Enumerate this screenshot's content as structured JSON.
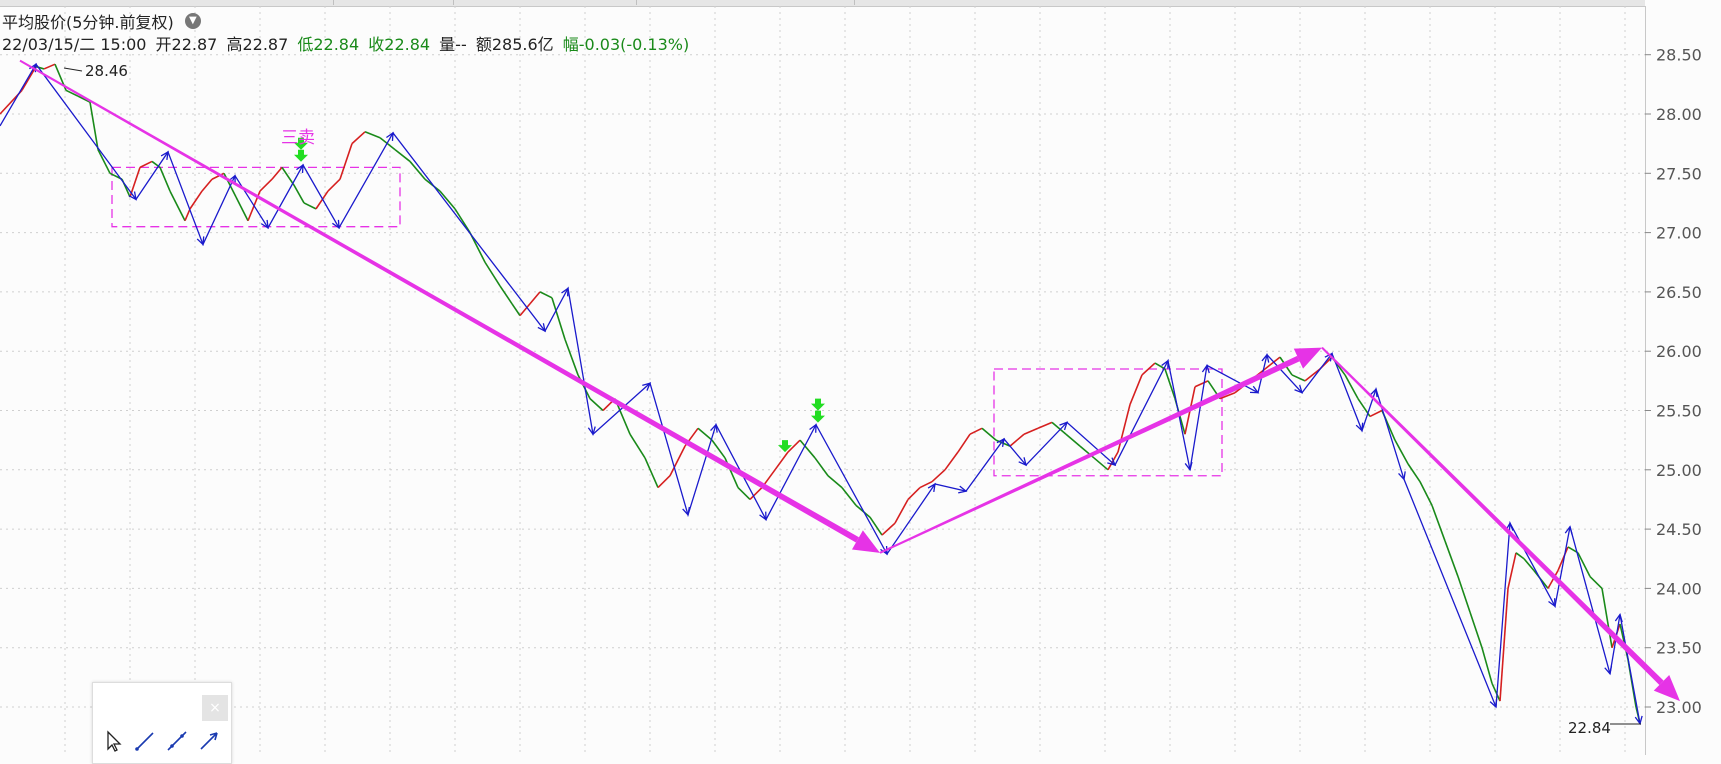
{
  "header": {
    "title": "平均股价(5分钟.前复权)",
    "dropdown_icon": "chevron-down-icon",
    "datetime": "22/03/15/二 15:00",
    "open": "开22.87",
    "high": "高22.87",
    "low": "低22.84",
    "close": "收22.84",
    "volume": "量--",
    "amount": "额285.6亿",
    "change": "幅-0.03(-0.13%)"
  },
  "annotations": {
    "high_marker": "28.46",
    "low_marker": "22.84",
    "signal_label": "三卖"
  },
  "toolbox": {
    "close_label": "×",
    "tools": [
      "cursor-icon",
      "line-icon",
      "segment-icon",
      "arrow-line-icon"
    ]
  },
  "colors": {
    "stroke_line": "#1a1acc",
    "trend_arrow": "#e633e6",
    "zone_box": "#e633e6",
    "up_candle": "#d62020",
    "down_candle": "#1a8a1a",
    "signal_arrow": "#22dd22",
    "grid": "#cfcfcf"
  },
  "chart_data": {
    "type": "line",
    "title": "平均股价(5分钟.前复权)",
    "xlabel": "",
    "ylabel": "",
    "ylim": [
      22.7,
      28.85
    ],
    "y_ticks": [
      "23.00",
      "23.50",
      "24.00",
      "24.50",
      "25.00",
      "25.50",
      "26.00",
      "26.50",
      "27.00",
      "27.50",
      "28.00",
      "28.50"
    ],
    "grid": true,
    "x_index_range": [
      0,
      1640
    ],
    "series": [
      {
        "values": [
          [
            0,
            28.0
          ],
          [
            22,
            28.2
          ],
          [
            36,
            28.4
          ],
          [
            44,
            28.38
          ],
          [
            55,
            28.42
          ],
          [
            66,
            28.2
          ],
          [
            78,
            28.15
          ],
          [
            90,
            28.1
          ],
          [
            98,
            27.7
          ],
          [
            110,
            27.5
          ],
          [
            122,
            27.45
          ],
          [
            130,
            27.3
          ],
          [
            140,
            27.55
          ],
          [
            152,
            27.6
          ],
          [
            160,
            27.55
          ],
          [
            170,
            27.35
          ],
          [
            185,
            27.1
          ],
          [
            190,
            27.2
          ],
          [
            202,
            27.35
          ],
          [
            212,
            27.45
          ],
          [
            224,
            27.5
          ],
          [
            236,
            27.3
          ],
          [
            248,
            27.1
          ],
          [
            260,
            27.35
          ],
          [
            272,
            27.45
          ],
          [
            282,
            27.55
          ],
          [
            294,
            27.4
          ],
          [
            304,
            27.25
          ],
          [
            316,
            27.2
          ],
          [
            328,
            27.35
          ],
          [
            340,
            27.45
          ],
          [
            352,
            27.75
          ],
          [
            365,
            27.85
          ],
          [
            380,
            27.8
          ],
          [
            395,
            27.7
          ],
          [
            410,
            27.6
          ],
          [
            425,
            27.45
          ],
          [
            440,
            27.35
          ],
          [
            455,
            27.2
          ],
          [
            470,
            27.0
          ],
          [
            485,
            26.75
          ],
          [
            500,
            26.55
          ],
          [
            512,
            26.4
          ],
          [
            520,
            26.3
          ],
          [
            530,
            26.4
          ],
          [
            540,
            26.5
          ],
          [
            552,
            26.45
          ],
          [
            565,
            26.1
          ],
          [
            578,
            25.8
          ],
          [
            590,
            25.6
          ],
          [
            603,
            25.5
          ],
          [
            615,
            25.6
          ],
          [
            630,
            25.3
          ],
          [
            645,
            25.1
          ],
          [
            658,
            24.85
          ],
          [
            670,
            24.95
          ],
          [
            685,
            25.2
          ],
          [
            698,
            25.35
          ],
          [
            712,
            25.25
          ],
          [
            725,
            25.1
          ],
          [
            738,
            24.85
          ],
          [
            750,
            24.75
          ],
          [
            762,
            24.85
          ],
          [
            775,
            25.0
          ],
          [
            788,
            25.15
          ],
          [
            800,
            25.25
          ],
          [
            815,
            25.1
          ],
          [
            828,
            24.95
          ],
          [
            842,
            24.85
          ],
          [
            856,
            24.7
          ],
          [
            870,
            24.6
          ],
          [
            882,
            24.45
          ],
          [
            895,
            24.55
          ],
          [
            908,
            24.75
          ],
          [
            920,
            24.85
          ],
          [
            932,
            24.9
          ],
          [
            945,
            25.0
          ],
          [
            958,
            25.15
          ],
          [
            970,
            25.3
          ],
          [
            982,
            25.35
          ],
          [
            996,
            25.25
          ],
          [
            1010,
            25.2
          ],
          [
            1024,
            25.3
          ],
          [
            1038,
            25.35
          ],
          [
            1052,
            25.4
          ],
          [
            1066,
            25.3
          ],
          [
            1080,
            25.2
          ],
          [
            1094,
            25.1
          ],
          [
            1108,
            25.0
          ],
          [
            1118,
            25.15
          ],
          [
            1130,
            25.55
          ],
          [
            1142,
            25.8
          ],
          [
            1155,
            25.9
          ],
          [
            1165,
            25.85
          ],
          [
            1175,
            25.6
          ],
          [
            1185,
            25.3
          ],
          [
            1195,
            25.7
          ],
          [
            1208,
            25.75
          ],
          [
            1220,
            25.6
          ],
          [
            1235,
            25.65
          ],
          [
            1250,
            25.75
          ],
          [
            1265,
            25.85
          ],
          [
            1280,
            25.95
          ],
          [
            1292,
            25.8
          ],
          [
            1305,
            25.75
          ],
          [
            1320,
            25.85
          ],
          [
            1332,
            25.95
          ],
          [
            1345,
            25.8
          ],
          [
            1358,
            25.6
          ],
          [
            1370,
            25.45
          ],
          [
            1382,
            25.5
          ],
          [
            1395,
            25.25
          ],
          [
            1408,
            25.05
          ],
          [
            1420,
            24.9
          ],
          [
            1432,
            24.7
          ],
          [
            1445,
            24.4
          ],
          [
            1458,
            24.1
          ],
          [
            1470,
            23.8
          ],
          [
            1482,
            23.5
          ],
          [
            1492,
            23.2
          ],
          [
            1500,
            23.05
          ],
          [
            1508,
            24.0
          ],
          [
            1516,
            24.3
          ],
          [
            1524,
            24.25
          ],
          [
            1534,
            24.15
          ],
          [
            1548,
            24.0
          ],
          [
            1558,
            24.15
          ],
          [
            1568,
            24.35
          ],
          [
            1578,
            24.3
          ],
          [
            1590,
            24.1
          ],
          [
            1602,
            24.0
          ],
          [
            1612,
            23.5
          ],
          [
            1620,
            23.7
          ],
          [
            1628,
            23.4
          ],
          [
            1636,
            23.0
          ],
          [
            1640,
            22.86
          ]
        ]
      },
      {
        "values": [
          [
            0,
            27.9
          ],
          [
            36,
            28.42
          ],
          [
            136,
            27.28
          ],
          [
            168,
            27.68
          ],
          [
            203,
            26.9
          ],
          [
            235,
            27.48
          ],
          [
            268,
            27.04
          ],
          [
            303,
            27.57
          ],
          [
            339,
            27.04
          ],
          [
            393,
            27.84
          ],
          [
            545,
            26.17
          ],
          [
            568,
            26.53
          ],
          [
            593,
            25.3
          ],
          [
            650,
            25.73
          ],
          [
            688,
            24.62
          ],
          [
            716,
            25.38
          ],
          [
            766,
            24.58
          ],
          [
            816,
            25.38
          ],
          [
            887,
            24.29
          ],
          [
            935,
            24.88
          ],
          [
            966,
            24.82
          ],
          [
            1004,
            25.26
          ],
          [
            1026,
            25.04
          ],
          [
            1067,
            25.4
          ],
          [
            1115,
            25.04
          ],
          [
            1168,
            25.92
          ],
          [
            1190,
            25.0
          ],
          [
            1207,
            25.88
          ],
          [
            1258,
            25.65
          ],
          [
            1267,
            25.97
          ],
          [
            1302,
            25.65
          ],
          [
            1332,
            25.98
          ],
          [
            1362,
            25.33
          ],
          [
            1376,
            25.68
          ],
          [
            1404,
            24.92
          ],
          [
            1496,
            23.0
          ],
          [
            1510,
            24.55
          ],
          [
            1555,
            23.85
          ],
          [
            1570,
            24.52
          ],
          [
            1610,
            23.28
          ],
          [
            1620,
            23.78
          ],
          [
            1640,
            22.86
          ]
        ]
      }
    ],
    "trend_arrows": [
      [
        [
          20,
          28.45
        ],
        [
          880,
          24.3
        ]
      ],
      [
        [
          880,
          24.3
        ],
        [
          1322,
          26.03
        ]
      ],
      [
        [
          1322,
          26.03
        ],
        [
          1680,
          23.05
        ]
      ]
    ],
    "zones": [
      [
        [
          112,
          27.55
        ],
        [
          400,
          27.05
        ]
      ],
      [
        [
          994,
          25.85
        ],
        [
          1222,
          24.95
        ]
      ]
    ],
    "signals": [
      [
        301,
        27.8
      ],
      [
        818,
        25.6
      ],
      [
        785,
        25.25
      ]
    ]
  }
}
